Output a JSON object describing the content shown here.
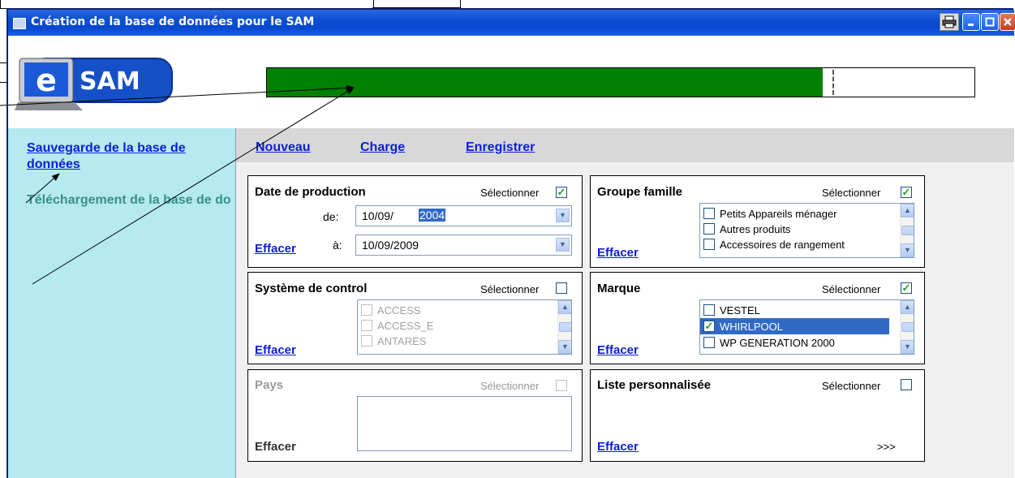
{
  "window": {
    "title": "Création de la base de données pour le SAM",
    "print_icon": "printer-icon",
    "minimize_icon": "minimize-icon",
    "maximize_icon": "maximize-icon",
    "close_icon": "close-icon"
  },
  "logo": {
    "letter": "e",
    "text": "SAM"
  },
  "progress": {
    "fraction": 0.785
  },
  "sidebar": {
    "items": [
      {
        "label": "Sauvegarde de la base de données"
      },
      {
        "label": "Téléchargement de la base de données"
      }
    ]
  },
  "menu": {
    "nouveau": "Nouveau",
    "charge": "Charge",
    "enregistrer": "Enregistrer"
  },
  "panels": {
    "date": {
      "title": "Date de production",
      "select_label": "Sélectionner",
      "selected": true,
      "from_label": "de:",
      "from_prefix": "10/09/",
      "from_highlight": "2004",
      "to_label": "à:",
      "to_value": "10/09/2009",
      "clear": "Effacer"
    },
    "groupe": {
      "title": "Groupe famille",
      "select_label": "Sélectionner",
      "selected": true,
      "items": [
        "Petits Appareils ménager",
        "Autres produits",
        "Accessoires de rangement"
      ],
      "clear": "Effacer"
    },
    "systeme": {
      "title": "Système de control",
      "select_label": "Sélectionner",
      "selected": false,
      "items": [
        "ACCESS",
        "ACCESS_E",
        "ANTARES"
      ],
      "clear": "Effacer"
    },
    "marque": {
      "title": "Marque",
      "select_label": "Sélectionner",
      "selected": true,
      "items": [
        "VESTEL",
        "WHIRLPOOL",
        "WP GENERATION 2000"
      ],
      "checked_item": "WHIRLPOOL",
      "clear": "Effacer"
    },
    "pays": {
      "title": "Pays",
      "select_label": "Sélectionner",
      "selected": false,
      "clear": "Effacer"
    },
    "liste": {
      "title": "Liste personnalisée",
      "select_label": "Sélectionner",
      "selected": false,
      "clear": "Effacer",
      "more": ">>>"
    }
  },
  "colors": {
    "progress": "#008000",
    "sidebar": "#b4eaf0",
    "link": "#0b1fd6",
    "titlebar": "#0b4fd2",
    "selection": "#316ac5"
  }
}
